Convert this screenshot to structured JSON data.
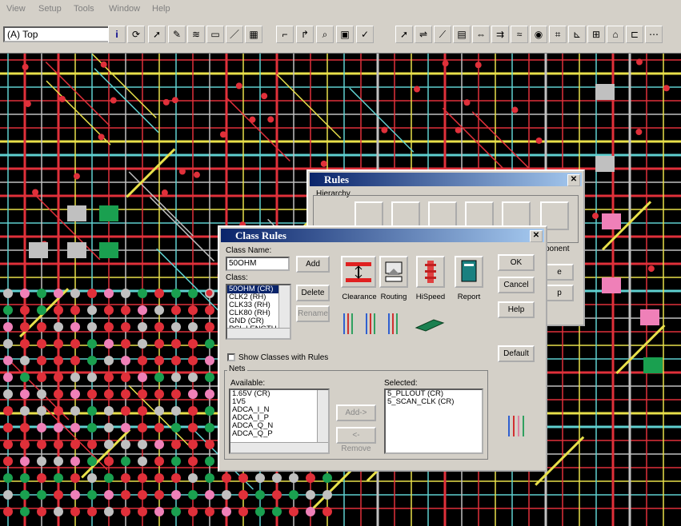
{
  "menu": [
    "View",
    "Setup",
    "Tools",
    "Window",
    "Help"
  ],
  "toolbar": {
    "layer_value": "(A) Top"
  },
  "rules_dialog": {
    "title": "Rules",
    "hierarchy_label": "Hierarchy",
    "partial_label": "ponent"
  },
  "class_rules": {
    "title": "Class Rules",
    "class_name_label": "Class Name:",
    "class_name_value": "50OHM",
    "add_label": "Add",
    "delete_label": "Delete",
    "rename_label": "Rename",
    "class_label": "Class:",
    "classes": [
      "50OHM (CR)",
      "CLK2 (RH)",
      "CLK33 (RH)",
      "CLK80 (RH)",
      "GND (CR)",
      "PCI_LENGTH"
    ],
    "icons": [
      "Clearance",
      "Routing",
      "HiSpeed",
      "Report"
    ],
    "ok_label": "OK",
    "cancel_label": "Cancel",
    "help_label": "Help",
    "default_label": "Default",
    "show_classes_label": "Show Classes with Rules",
    "nets_label": "Nets",
    "available_label": "Available:",
    "available": [
      "1.65V (CR)",
      "1V5",
      "ADCA_I_N",
      "ADCA_I_P",
      "ADCA_Q_N",
      "ADCA_Q_P"
    ],
    "selected_label": "Selected:",
    "selected": [
      "5_PLLOUT (CR)",
      "5_SCAN_CLK (CR)"
    ],
    "add_arrow_label": "Add->",
    "remove_label": "<-Remove"
  },
  "colors": {
    "trace_red": "#e0303a",
    "trace_yellow": "#e8e04a",
    "trace_cyan": "#5fd0d0",
    "trace_pink": "#ef80b8",
    "trace_gray": "#c0c0c0",
    "pad_green": "#1aa050",
    "titlebar": "#0a246a"
  }
}
